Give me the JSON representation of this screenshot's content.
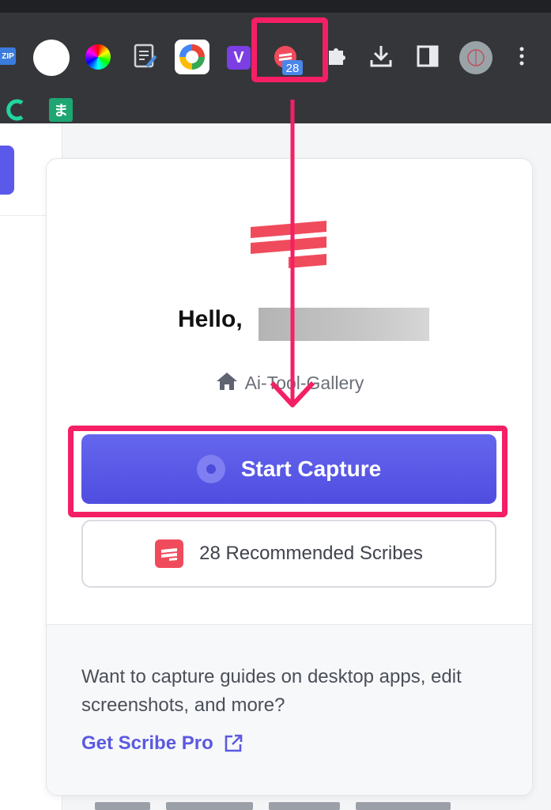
{
  "toolbar": {
    "icons": [
      {
        "name": "zip-extension-icon",
        "label": "ZIP"
      },
      {
        "name": "white-circle-extension-icon"
      },
      {
        "name": "color-wheel-extension-icon"
      },
      {
        "name": "notes-extension-icon"
      },
      {
        "name": "google-extension-icon"
      },
      {
        "name": "v-extension-icon",
        "label": "V"
      },
      {
        "name": "scribe-extension-icon"
      },
      {
        "name": "extensions-puzzle-icon"
      },
      {
        "name": "download-icon"
      },
      {
        "name": "side-panel-icon"
      },
      {
        "name": "profile-avatar"
      },
      {
        "name": "more-menu-icon"
      }
    ],
    "scribe_badge": "28",
    "bookmarks": [
      {
        "name": "c-bookmark-icon"
      },
      {
        "name": "m-bookmark-icon",
        "label": "ま"
      }
    ]
  },
  "popup": {
    "greeting": "Hello,",
    "workspace": "Ai-Tool-Gallery",
    "start_capture_label": "Start Capture",
    "recommended_label": "28 Recommended Scribes",
    "promo_text": "Want to capture guides on desktop apps, edit screenshots, and more?",
    "pro_link_label": "Get Scribe Pro"
  },
  "colors": {
    "brand_red": "#f04b5c",
    "primary_button": "#5b59e9",
    "highlight": "#f41f64",
    "link": "#5b59e0",
    "toolbar_bg": "#35363a"
  }
}
